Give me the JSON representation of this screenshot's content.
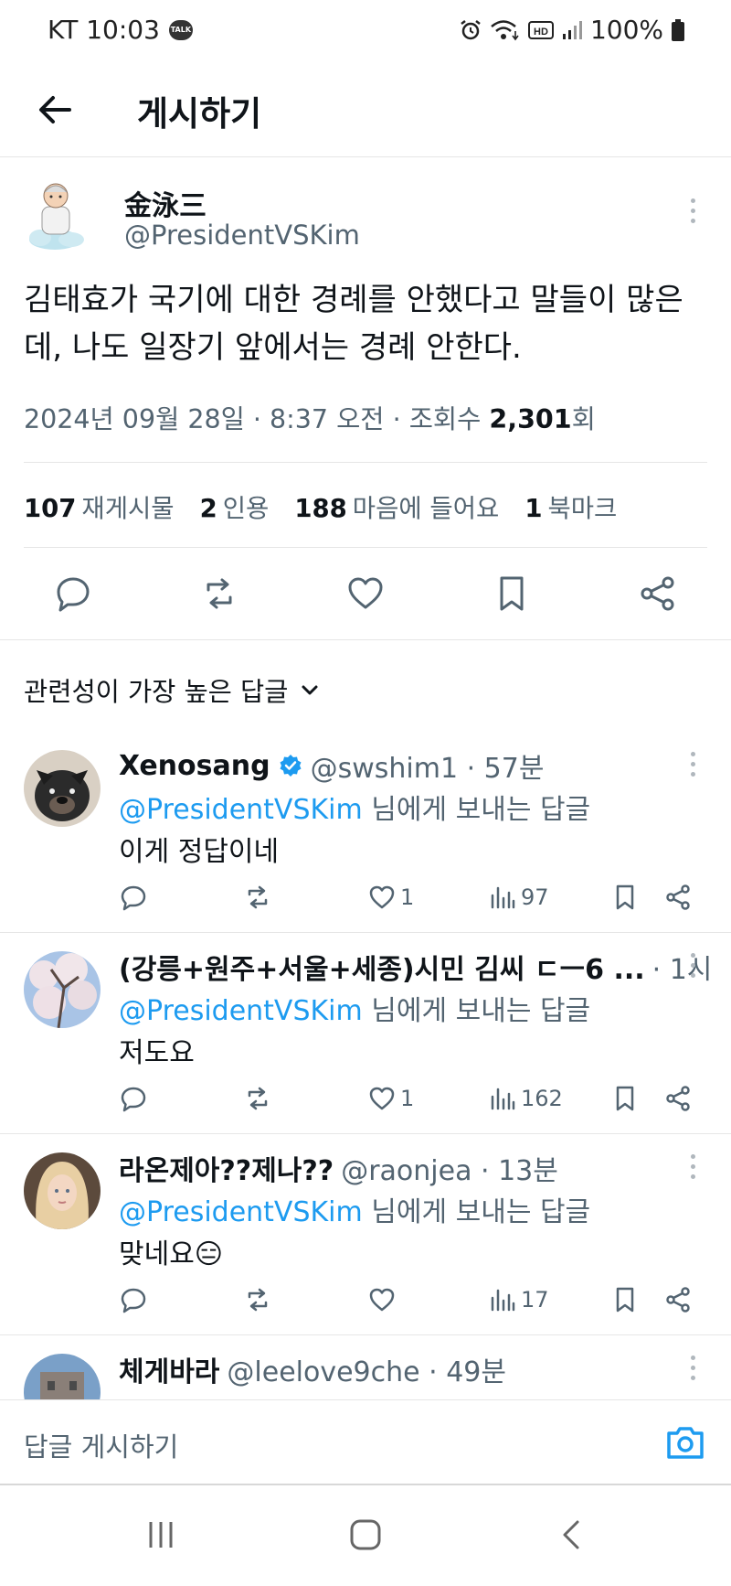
{
  "status_bar": {
    "carrier_time": "KT 10:03",
    "talk_badge": "TALK",
    "battery": "100%"
  },
  "header": {
    "title": "게시하기"
  },
  "post": {
    "name": "金泳三",
    "handle": "@PresidentVSKim",
    "text": "김태효가 국기에 대한 경례를 안했다고 말들이 많은데, 나도 일장기 앞에서는 경례 안한다.",
    "meta_prefix": "2024년 09월 28일 · 8:37 오전 · 조회수 ",
    "meta_views": "2,301",
    "meta_suffix": "회"
  },
  "stats": [
    {
      "count": "107",
      "label": "재게시물"
    },
    {
      "count": "2",
      "label": "인용"
    },
    {
      "count": "188",
      "label": "마음에 들어요"
    },
    {
      "count": "1",
      "label": "북마크"
    }
  ],
  "sort": {
    "label": "관련성이 가장 높은 답글"
  },
  "reply_to_label": "님에게 보내는 답글",
  "replies": [
    {
      "name": "Xenosang",
      "handle": "@swshim1 · 57분",
      "mention": "@PresidentVSKim",
      "body": "이게 정답이네",
      "likes": "1",
      "views": "97",
      "verified": true
    },
    {
      "name": "(강릉+원주+서울+세종)시민 김씨 ㄷㅡ6 ...",
      "handle": "· 1시",
      "mention": "@PresidentVSKim",
      "body": "저도요",
      "likes": "1",
      "views": "162",
      "verified": false
    },
    {
      "name": "라온제아??제나??",
      "handle": "@raonjea · 13분",
      "mention": "@PresidentVSKim",
      "body": "맞네요😑",
      "likes": "",
      "views": "17",
      "verified": false
    },
    {
      "name": "체게바라",
      "handle": "@leelove9che · 49분",
      "mention": "",
      "body": "",
      "likes": "",
      "views": "",
      "verified": false
    }
  ],
  "composer": {
    "placeholder": "답글 게시하기"
  },
  "colors": {
    "accent": "#1d9bf0",
    "secondary_text": "#536471",
    "primary_text": "#0f1419"
  }
}
